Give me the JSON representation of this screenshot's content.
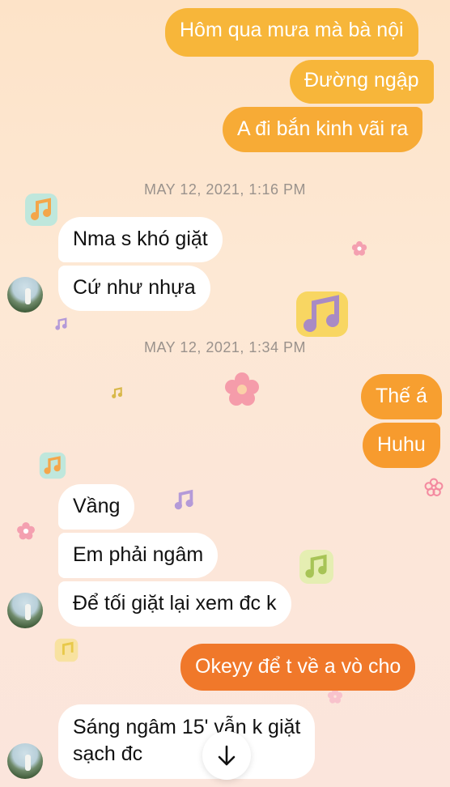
{
  "colors": {
    "outgoing_light": "#f7b63a",
    "outgoing_mid": "#f79b2e",
    "outgoing_dark": "#f0782a",
    "incoming": "#ffffff",
    "timestamp": "#9a928c"
  },
  "thread": {
    "outgoing_top": [
      "Hôm qua mưa mà bà nội",
      "Đường ngập",
      "A đi bắn kinh vãi ra"
    ],
    "timestamp_1": "MAY 12, 2021, 1:16 PM",
    "incoming_1": [
      "Nma s khó giặt",
      "Cứ như nhựa"
    ],
    "timestamp_2": "MAY 12, 2021, 1:34 PM",
    "outgoing_mid": [
      "Thế á",
      "Huhu"
    ],
    "incoming_2": [
      "Vầng",
      "Em phải ngâm",
      "Để tối giặt lại xem đc k"
    ],
    "outgoing_bottom": "Okeyy để t về a vò cho",
    "incoming_3": {
      "line1": "Sáng ngâm 15' vẫn k giặt",
      "line2": "sạch đc"
    }
  },
  "icons": {
    "avatar": "avatar-photo",
    "scroll": "arrow-down-icon",
    "stickers": [
      "music-note-icon",
      "flower-icon"
    ]
  }
}
